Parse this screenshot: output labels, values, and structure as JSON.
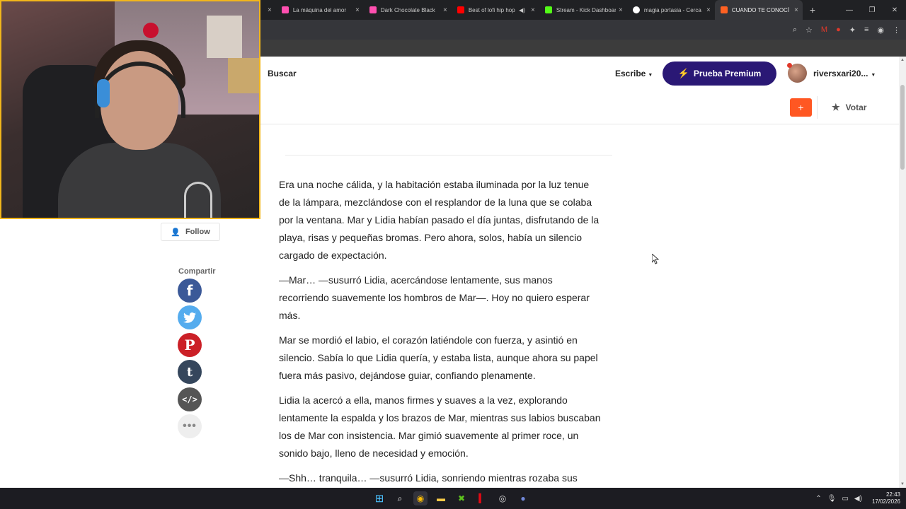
{
  "browser": {
    "tabs": [
      {
        "title": "La máquina del amor",
        "color": "#ff4fb0",
        "audio": false,
        "active": false
      },
      {
        "title": "Dark Chocolate Black",
        "color": "#ff4fb0",
        "audio": false,
        "active": false
      },
      {
        "title": "Best of lofi hip hop",
        "color": "#ff0000",
        "audio": true,
        "active": false
      },
      {
        "title": "Stream - Kick Dashboard",
        "color": "#53fc18",
        "audio": false,
        "active": false
      },
      {
        "title": "magia portasia - Cerca",
        "color": "#ffffff",
        "audio": false,
        "active": false
      },
      {
        "title": "CUANDO TE CONOCÍ",
        "color": "#ff6122",
        "audio": false,
        "active": true
      }
    ],
    "new_tab": "+",
    "close_glyph": "×"
  },
  "header": {
    "search_label": "Buscar",
    "write_label": "Escribe",
    "premium_label": "Prueba Premium",
    "username": "riversxari20...",
    "add_label": "+",
    "vote_label": "Votar"
  },
  "sidebar": {
    "follow_label": "Follow",
    "share_label": "Compartir",
    "share_icons": {
      "facebook": "f",
      "twitter": "t",
      "pinterest": "P",
      "tumblr": "t",
      "embed": "</>",
      "more": "•••"
    }
  },
  "story": {
    "paragraphs": [
      "Era una noche cálida, y la habitación estaba iluminada por la luz tenue de la lámpara, mezclándose con el resplandor de la luna que se colaba por la ventana. Mar y Lidia habían pasado el día juntas, disfrutando de la playa, risas y pequeñas bromas. Pero ahora, solos, había un silencio cargado de expectación.",
      "—Mar… —susurró Lidia, acercándose lentamente, sus manos recorriendo suavemente los hombros de Mar—. Hoy no quiero esperar más.",
      "Mar se mordió el labio, el corazón latiéndole con fuerza, y asintió en silencio. Sabía lo que Lidia quería, y estaba lista, aunque ahora su papel fuera más pasivo, dejándose guiar, confiando plenamente.",
      "Lidia la acercó a ella, manos firmes y suaves a la vez, explorando lentamente la espalda y los brazos de Mar, mientras sus labios buscaban los de Mar con insistencia. Mar gimió suavemente al primer roce, un sonido bajo, lleno de necesidad y emoción.",
      "—Shh… tranquila… —susurró Lidia, sonriendo mientras rozaba sus"
    ]
  },
  "taskbar": {
    "time": "22:43",
    "date": "17/02/2026"
  }
}
